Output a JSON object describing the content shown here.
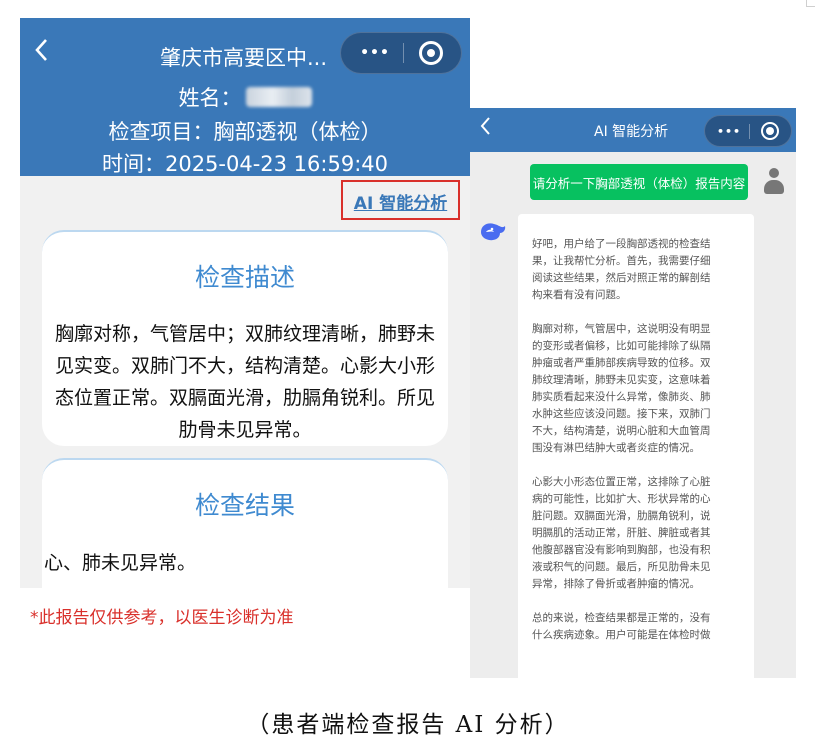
{
  "left_screen": {
    "header": {
      "title": "肇庆市高要区中...",
      "more_glyph": "•••",
      "name_label": "姓名：",
      "exam_item": "检查项目：胸部透视（体检）",
      "time": "时间：2025-04-23 16:59:40"
    },
    "ai_link": "AI 智能分析",
    "description": {
      "title": "检查描述",
      "lines": [
        "胸廓对称，气管居中；双肺纹理清晰，肺野未",
        "见实变。双肺门不大，结构清楚。心影大小形",
        "态位置正常。双膈面光滑，肋膈角锐利。所见",
        "肋骨未见异常。"
      ]
    },
    "result": {
      "title": "检查结果",
      "text": "心、肺未见异常。"
    },
    "disclaimer": "*此报告仅供参考，以医生诊断为准"
  },
  "right_screen": {
    "header": {
      "title": "AI 智能分析",
      "more_glyph": "•••"
    },
    "user_message": "请分析一下胸部透视（体检）报告内容",
    "ai_reply": {
      "p1": [
        "好吧，用户给了一段胸部透视的检查结",
        "果，让我帮忙分析。首先，我需要仔细",
        "阅读这些结果，然后对照正常的解剖结",
        "构来看有没有问题。"
      ],
      "p2": [
        "胸廓对称，气管居中，这说明没有明显",
        "的变形或者偏移，比如可能排除了纵隔",
        "肿瘤或者严重肺部疾病导致的位移。双",
        "肺纹理清晰，肺野未见实变，这意味着",
        "肺实质看起来没什么异常，像肺炎、肺",
        "水肿这些应该没问题。接下来，双肺门",
        "不大，结构清楚，说明心脏和大血管周",
        "围没有淋巴结肿大或者炎症的情况。"
      ],
      "p3": [
        "心影大小形态位置正常，这排除了心脏",
        "病的可能性，比如扩大、形状异常的心",
        "脏问题。双膈面光滑，肋膈角锐利，说",
        "明膈肌的活动正常，肝脏、脾脏或者其",
        "他腹部器官没有影响到胸部，也没有积",
        "液或积气的问题。最后，所见肋骨未见",
        "异常，排除了骨折或者肿瘤的情况。"
      ],
      "p4": [
        "总的来说，检查结果都是正常的，没有",
        "什么疾病迹象。用户可能是在体检时做"
      ]
    }
  },
  "caption": "（患者端检查报告 AI 分析）",
  "colors": {
    "header_blue": "#3a78b8",
    "title_blue": "#3f8ad0",
    "alert_red": "#d9302b",
    "send_green": "#07c160"
  }
}
